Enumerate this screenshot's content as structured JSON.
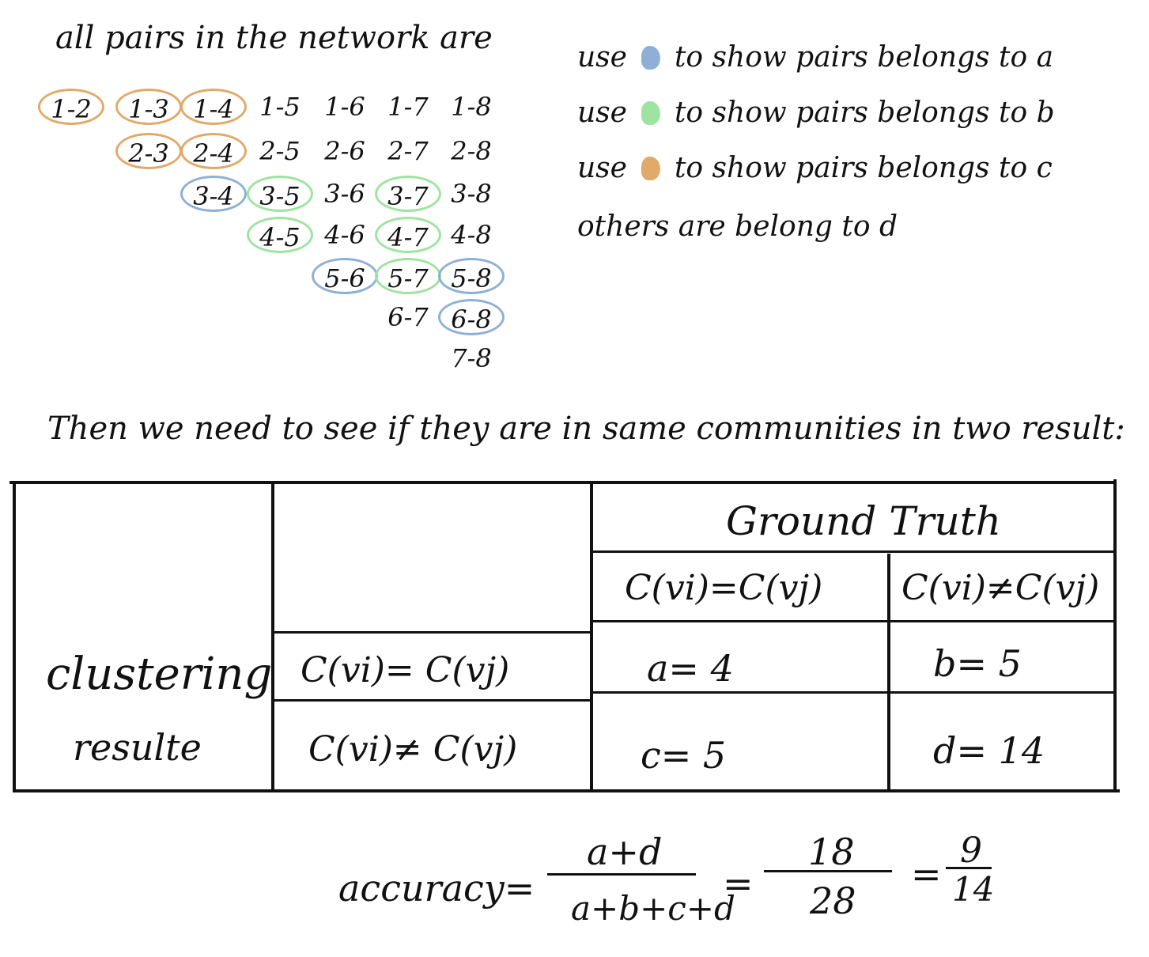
{
  "colors": {
    "a": "#8fb0d6",
    "b": "#9fe3a0",
    "c": "#e0aa6a",
    "ink": "#111111"
  },
  "heading": "all pairs in the network are",
  "pairs": [
    [
      "1-2",
      "1-3",
      "1-4",
      "1-5",
      "1-6",
      "1-7",
      "1-8"
    ],
    [
      "2-3",
      "2-4",
      "2-5",
      "2-6",
      "2-7",
      "2-8"
    ],
    [
      "3-4",
      "3-5",
      "3-6",
      "3-7",
      "3-8"
    ],
    [
      "4-5",
      "4-6",
      "4-7",
      "4-8"
    ],
    [
      "5-6",
      "5-7",
      "5-8"
    ],
    [
      "6-7",
      "6-8"
    ],
    [
      "7-8"
    ]
  ],
  "pair_groups": {
    "a": [
      "3-4",
      "5-6",
      "5-8",
      "6-8"
    ],
    "b": [
      "3-5",
      "3-7",
      "4-5",
      "4-7",
      "5-7"
    ],
    "c": [
      "1-2",
      "1-3",
      "1-4",
      "2-3",
      "2-4"
    ]
  },
  "legend": {
    "a": {
      "prefix": "use",
      "suffix": "to show pairs belongs to a"
    },
    "b": {
      "prefix": "use",
      "suffix": "to show pairs belongs to b"
    },
    "c": {
      "prefix": "use",
      "suffix": "to show pairs belongs to c"
    },
    "d": "others are belong to d"
  },
  "sentence": "Then we need to see if they are in same communities in two result:",
  "table": {
    "ground_truth": "Ground Truth",
    "gt_same": "C(vi)=C(vj)",
    "gt_diff": "C(vi)≠C(vj)",
    "clustering": "clustering",
    "result": "resulte",
    "cl_same": "C(vi)= C(vj)",
    "cl_diff": "C(vi)≠ C(vj)",
    "a": "a= 4",
    "b": "b= 5",
    "c": "c= 5",
    "d": "d= 14"
  },
  "formula": {
    "label": "accuracy=",
    "num1": "a+d",
    "den1": "a+b+c+d",
    "eq1": "=",
    "num2": "18",
    "den2": "28",
    "eq2": "=",
    "num3": "9",
    "den3": "14"
  }
}
